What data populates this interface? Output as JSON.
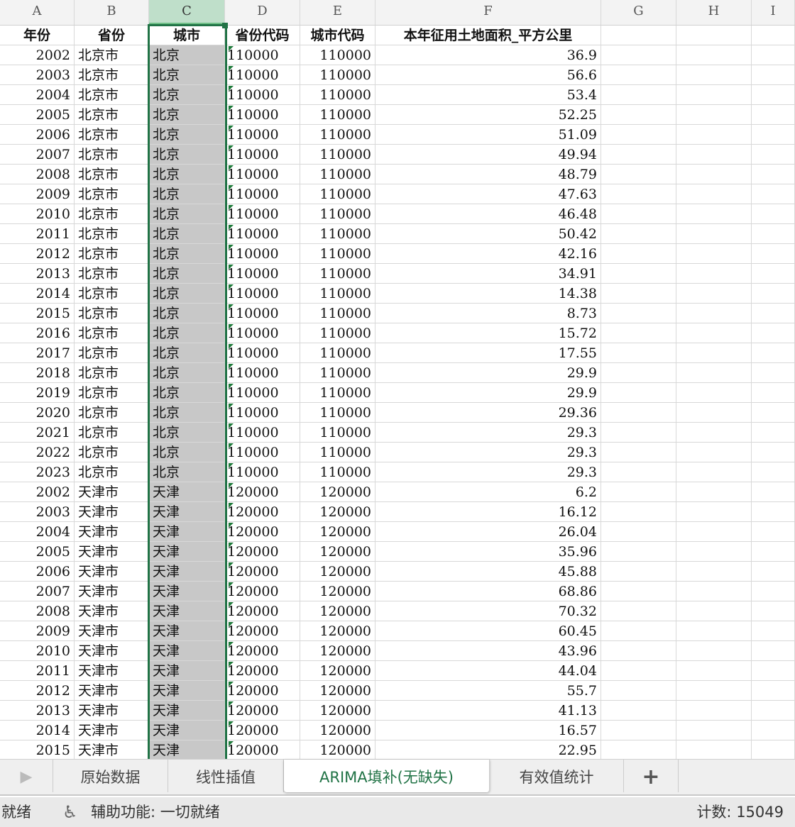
{
  "columns": [
    "A",
    "B",
    "C",
    "D",
    "E",
    "F",
    "G",
    "H",
    "I"
  ],
  "selected_column": "C",
  "headers": [
    "年份",
    "省份",
    "城市",
    "省份代码",
    "城市代码",
    "本年征用土地面积_平方公里"
  ],
  "rows": [
    [
      "2002",
      "北京市",
      "北京",
      "110000",
      "110000",
      "36.9"
    ],
    [
      "2003",
      "北京市",
      "北京",
      "110000",
      "110000",
      "56.6"
    ],
    [
      "2004",
      "北京市",
      "北京",
      "110000",
      "110000",
      "53.4"
    ],
    [
      "2005",
      "北京市",
      "北京",
      "110000",
      "110000",
      "52.25"
    ],
    [
      "2006",
      "北京市",
      "北京",
      "110000",
      "110000",
      "51.09"
    ],
    [
      "2007",
      "北京市",
      "北京",
      "110000",
      "110000",
      "49.94"
    ],
    [
      "2008",
      "北京市",
      "北京",
      "110000",
      "110000",
      "48.79"
    ],
    [
      "2009",
      "北京市",
      "北京",
      "110000",
      "110000",
      "47.63"
    ],
    [
      "2010",
      "北京市",
      "北京",
      "110000",
      "110000",
      "46.48"
    ],
    [
      "2011",
      "北京市",
      "北京",
      "110000",
      "110000",
      "50.42"
    ],
    [
      "2012",
      "北京市",
      "北京",
      "110000",
      "110000",
      "42.16"
    ],
    [
      "2013",
      "北京市",
      "北京",
      "110000",
      "110000",
      "34.91"
    ],
    [
      "2014",
      "北京市",
      "北京",
      "110000",
      "110000",
      "14.38"
    ],
    [
      "2015",
      "北京市",
      "北京",
      "110000",
      "110000",
      "8.73"
    ],
    [
      "2016",
      "北京市",
      "北京",
      "110000",
      "110000",
      "15.72"
    ],
    [
      "2017",
      "北京市",
      "北京",
      "110000",
      "110000",
      "17.55"
    ],
    [
      "2018",
      "北京市",
      "北京",
      "110000",
      "110000",
      "29.9"
    ],
    [
      "2019",
      "北京市",
      "北京",
      "110000",
      "110000",
      "29.9"
    ],
    [
      "2020",
      "北京市",
      "北京",
      "110000",
      "110000",
      "29.36"
    ],
    [
      "2021",
      "北京市",
      "北京",
      "110000",
      "110000",
      "29.3"
    ],
    [
      "2022",
      "北京市",
      "北京",
      "110000",
      "110000",
      "29.3"
    ],
    [
      "2023",
      "北京市",
      "北京",
      "110000",
      "110000",
      "29.3"
    ],
    [
      "2002",
      "天津市",
      "天津",
      "120000",
      "120000",
      "6.2"
    ],
    [
      "2003",
      "天津市",
      "天津",
      "120000",
      "120000",
      "16.12"
    ],
    [
      "2004",
      "天津市",
      "天津",
      "120000",
      "120000",
      "26.04"
    ],
    [
      "2005",
      "天津市",
      "天津",
      "120000",
      "120000",
      "35.96"
    ],
    [
      "2006",
      "天津市",
      "天津",
      "120000",
      "120000",
      "45.88"
    ],
    [
      "2007",
      "天津市",
      "天津",
      "120000",
      "120000",
      "68.86"
    ],
    [
      "2008",
      "天津市",
      "天津",
      "120000",
      "120000",
      "70.32"
    ],
    [
      "2009",
      "天津市",
      "天津",
      "120000",
      "120000",
      "60.45"
    ],
    [
      "2010",
      "天津市",
      "天津",
      "120000",
      "120000",
      "43.96"
    ],
    [
      "2011",
      "天津市",
      "天津",
      "120000",
      "120000",
      "44.04"
    ],
    [
      "2012",
      "天津市",
      "天津",
      "120000",
      "120000",
      "55.7"
    ],
    [
      "2013",
      "天津市",
      "天津",
      "120000",
      "120000",
      "41.13"
    ],
    [
      "2014",
      "天津市",
      "天津",
      "120000",
      "120000",
      "16.57"
    ],
    [
      "2015",
      "天津市",
      "天津",
      "120000",
      "120000",
      "22.95"
    ]
  ],
  "sheet_tabs": [
    "原始数据",
    "线性插值",
    "ARIMA填补(无缺失)",
    "有效值统计"
  ],
  "active_tab": 2,
  "add_sheet": "+",
  "status": {
    "ready": "就绪",
    "accessibility": "辅助功能: 一切就绪",
    "count": "计数: 15049"
  },
  "colors": {
    "accent": "#217346"
  }
}
